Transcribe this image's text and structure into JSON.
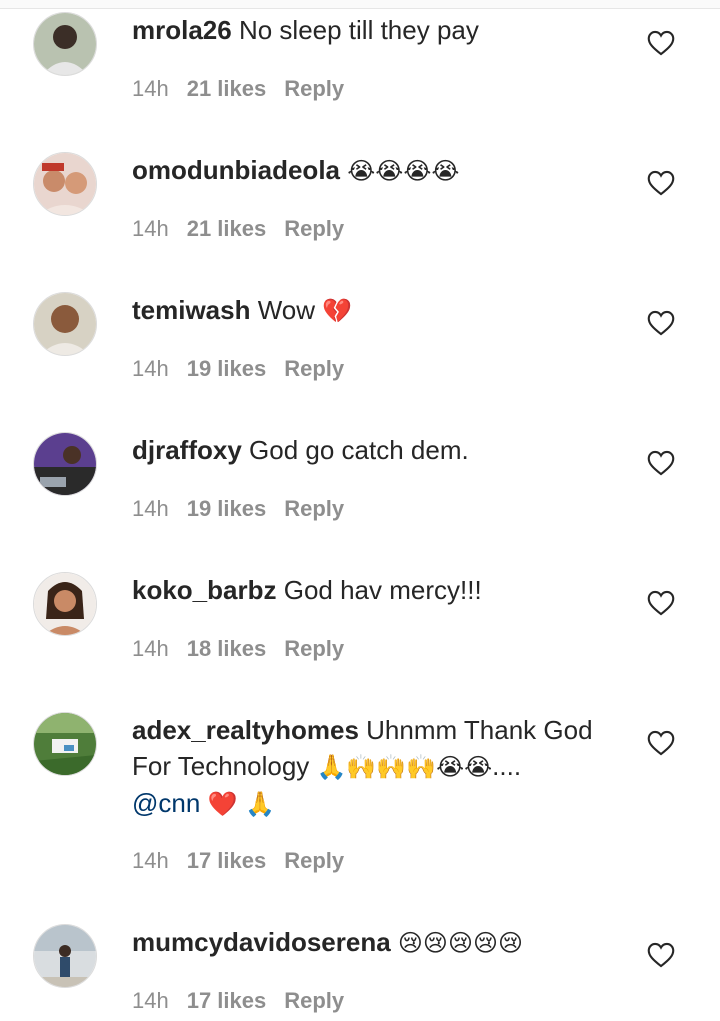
{
  "comments": [
    {
      "username": "mrola26",
      "text": "No sleep till they pay",
      "emoji": "",
      "extra": "",
      "time": "14h",
      "likes": "21 likes",
      "reply": "Reply",
      "avatar": "profile-photo"
    },
    {
      "username": "omodunbiadeola",
      "text": "",
      "emoji": "😭😭😭😭",
      "extra": "",
      "time": "14h",
      "likes": "21 likes",
      "reply": "Reply",
      "avatar": "profile-photo"
    },
    {
      "username": "temiwash",
      "text": "Wow",
      "emoji": "💔",
      "extra": "",
      "time": "14h",
      "likes": "19 likes",
      "reply": "Reply",
      "avatar": "profile-photo"
    },
    {
      "username": "djraffoxy",
      "text": "God go catch dem.",
      "emoji": "",
      "extra": "",
      "time": "14h",
      "likes": "19 likes",
      "reply": "Reply",
      "avatar": "profile-photo"
    },
    {
      "username": "koko_barbz",
      "text": "God hav mercy!!!",
      "emoji": "",
      "extra": "",
      "time": "14h",
      "likes": "18 likes",
      "reply": "Reply",
      "avatar": "profile-photo"
    },
    {
      "username": "adex_realtyhomes",
      "text": "Uhnmm Thank God For Technology",
      "emoji": "🙏🙌🙌🙌😭😭",
      "extra": "....",
      "mention": "@cnn",
      "mention_emoji": "❤️ 🙏",
      "time": "14h",
      "likes": "17 likes",
      "reply": "Reply",
      "avatar": "profile-photo"
    },
    {
      "username": "mumcydavidoserena",
      "text": "",
      "emoji": "😢😢😢😢😢",
      "extra": "",
      "time": "14h",
      "likes": "17 likes",
      "reply": "Reply",
      "avatar": "profile-photo"
    }
  ],
  "colors": {
    "text": "#262626",
    "meta": "#8e8e8e",
    "background": "#ffffff"
  },
  "icons": {
    "like": "heart-outline-icon"
  }
}
